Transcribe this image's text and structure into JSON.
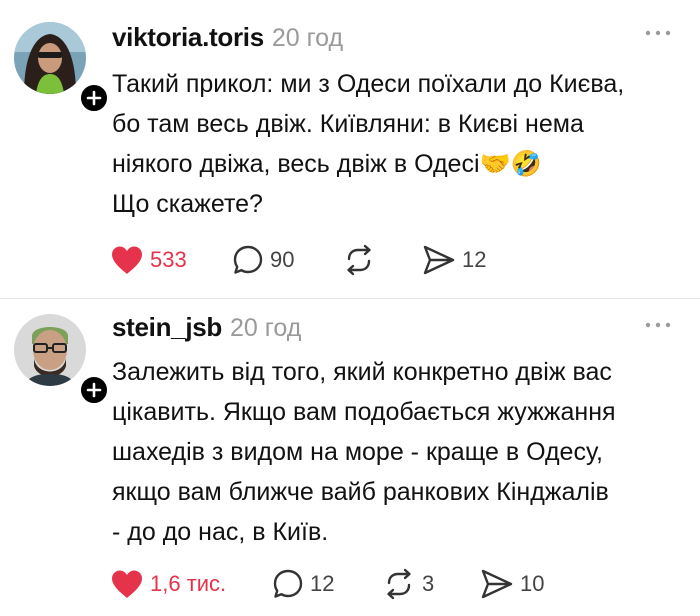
{
  "posts": [
    {
      "username": "viktoria.toris",
      "timestamp": "20 год",
      "text": "Такий прикол: ми з Одеси поїхали до Києва,\nбо там весь двіж. Київляни: в Києві нема\nніякого двіжа, весь двіж в Одесі🤝🤣\nЩо скажете?",
      "likes": "533",
      "comments": "90",
      "reposts": "",
      "shares": "12",
      "liked": true
    },
    {
      "username": "stein_jsb",
      "timestamp": "20 год",
      "text": "Залежить від того, який конкретно двіж вас\nцікавить. Якщо вам подобається жужжання\nшахедів з видом на море - краще в Одесу,\nякщо вам ближче вайб ранкових Кінджалів\n- до до нас, в Київ.",
      "likes": "1,6 тис.",
      "comments": "12",
      "reposts": "3",
      "shares": "10",
      "liked": true
    }
  ],
  "colors": {
    "like": "#e5334b",
    "muted": "#9a9a9a",
    "text": "#121212"
  },
  "icons": [
    "heart-icon",
    "comment-icon",
    "repost-icon",
    "share-icon",
    "more-icon",
    "plus-icon"
  ]
}
